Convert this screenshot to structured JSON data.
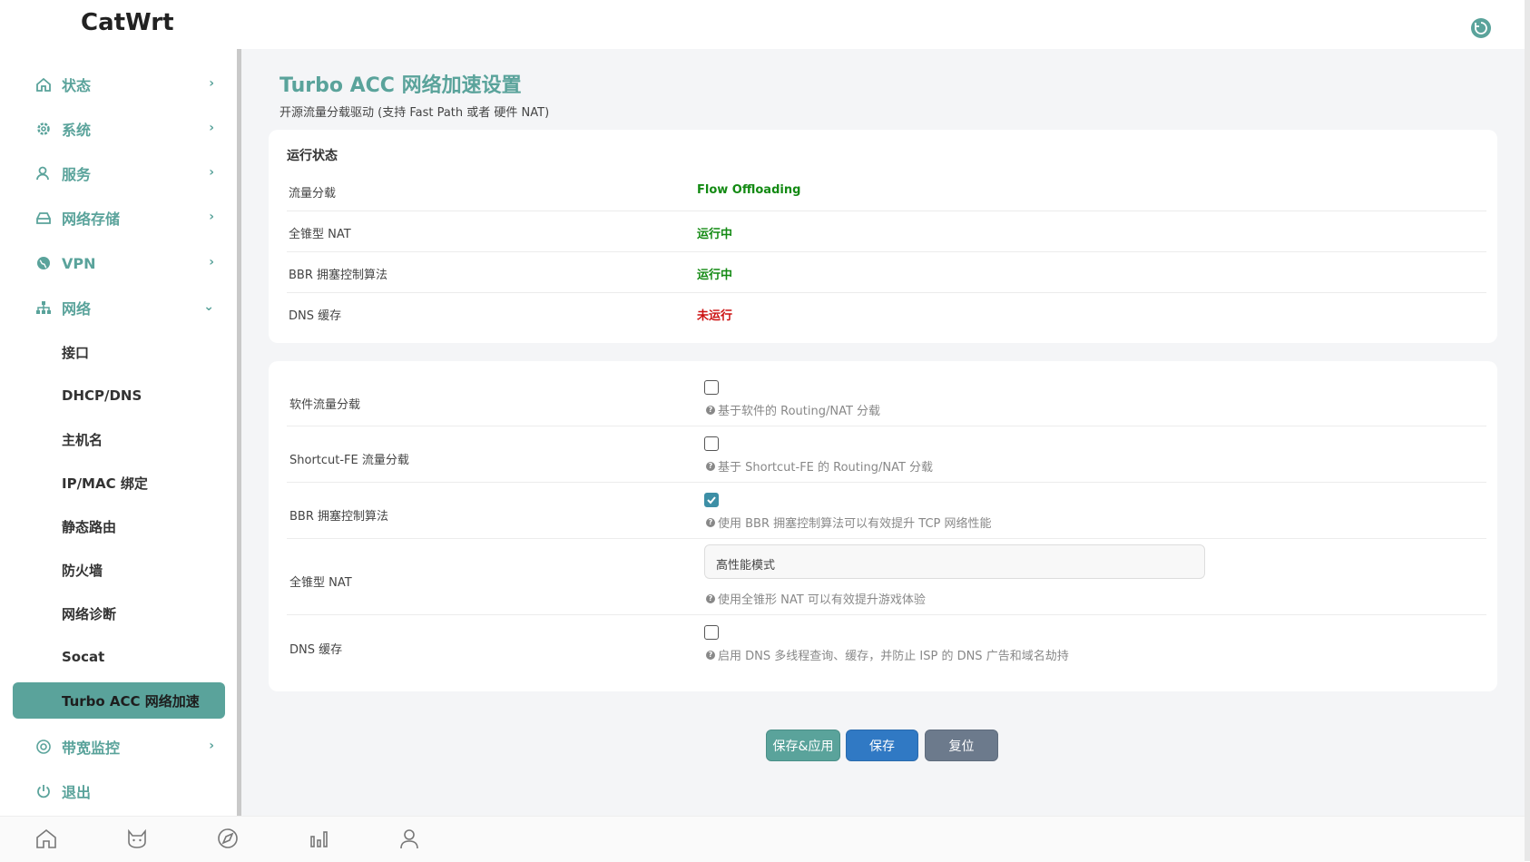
{
  "app": {
    "brand": "CatWrt"
  },
  "colors": {
    "accent": "#5aa39b",
    "ok": "#138a13",
    "bad": "#cc1111",
    "save": "#3079c4",
    "reset": "#6c7a8c"
  },
  "sidebar": {
    "items": [
      {
        "label": "状态",
        "icon": "home-icon"
      },
      {
        "label": "系统",
        "icon": "gear-icon"
      },
      {
        "label": "服务",
        "icon": "user-service-icon"
      },
      {
        "label": "网络存储",
        "icon": "storage-icon"
      },
      {
        "label": "VPN",
        "icon": "globe-icon"
      },
      {
        "label": "网络",
        "icon": "network-tree-icon"
      }
    ],
    "network_sub": [
      "接口",
      "DHCP/DNS",
      "主机名",
      "IP/MAC 绑定",
      "静态路由",
      "防火墙",
      "网络诊断",
      "Socat"
    ],
    "active_sub": "Turbo ACC 网络加速",
    "bottom_items": [
      {
        "label": "带宽监控",
        "icon": "target-icon"
      },
      {
        "label": "退出",
        "icon": "power-icon"
      }
    ]
  },
  "page": {
    "title": "Turbo ACC 网络加速设置",
    "desc": "开源流量分载驱动 (支持 Fast Path 或者 硬件 NAT)"
  },
  "status": {
    "section_title": "运行状态",
    "rows": [
      {
        "label": "流量分载",
        "value": "Flow Offloading",
        "state": "ok"
      },
      {
        "label": "全锥型 NAT",
        "value": "运行中",
        "state": "ok"
      },
      {
        "label": "BBR 拥塞控制算法",
        "value": "运行中",
        "state": "ok"
      },
      {
        "label": "DNS 缓存",
        "value": "未运行",
        "state": "bad"
      }
    ]
  },
  "config": {
    "sw_flow": {
      "label": "软件流量分载",
      "checked": false,
      "hint": "基于软件的 Routing/NAT 分载"
    },
    "sfe_flow": {
      "label": "Shortcut-FE 流量分载",
      "checked": false,
      "hint": "基于 Shortcut-FE 的 Routing/NAT 分载"
    },
    "bbr": {
      "label": "BBR 拥塞控制算法",
      "checked": true,
      "hint": "使用 BBR 拥塞控制算法可以有效提升 TCP 网络性能"
    },
    "fullcone": {
      "label": "全锥型 NAT",
      "selected": "高性能模式",
      "hint": "使用全锥形 NAT 可以有效提升游戏体验"
    },
    "dns_cache": {
      "label": "DNS 缓存",
      "checked": false,
      "hint": "启用 DNS 多线程查询、缓存，并防止 ISP 的 DNS 广告和域名劫持"
    }
  },
  "buttons": {
    "apply": "保存&应用",
    "save": "保存",
    "reset": "复位"
  },
  "bottom_nav": [
    "home-icon",
    "cat-icon",
    "compass-icon",
    "bar-chart-icon",
    "user-icon"
  ]
}
